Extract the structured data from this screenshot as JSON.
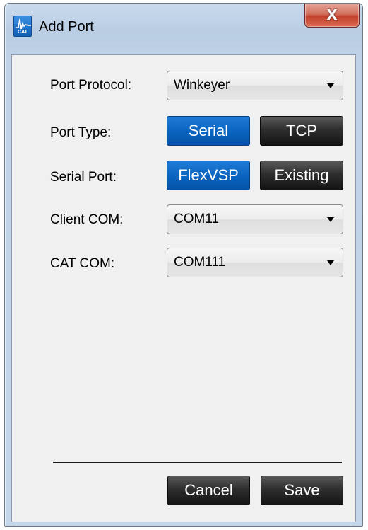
{
  "window": {
    "title": "Add Port",
    "icon_name": "cat-app-icon",
    "icon_label": "CAT",
    "close_glyph": "X"
  },
  "form": {
    "port_protocol": {
      "label": "Port Protocol:",
      "value": "Winkeyer"
    },
    "port_type": {
      "label": "Port Type:",
      "options": [
        {
          "label": "Serial",
          "selected": true
        },
        {
          "label": "TCP",
          "selected": false
        }
      ]
    },
    "serial_port": {
      "label": "Serial Port:",
      "options": [
        {
          "label": "FlexVSP",
          "selected": true
        },
        {
          "label": "Existing",
          "selected": false
        }
      ]
    },
    "client_com": {
      "label": "Client COM:",
      "value": "COM11"
    },
    "cat_com": {
      "label": "CAT COM:",
      "value": "COM111"
    }
  },
  "footer": {
    "cancel_label": "Cancel",
    "save_label": "Save"
  },
  "colors": {
    "selected_button": "#0a65c1",
    "unselected_button": "#2e2e2e",
    "close_button": "#c2402b"
  }
}
